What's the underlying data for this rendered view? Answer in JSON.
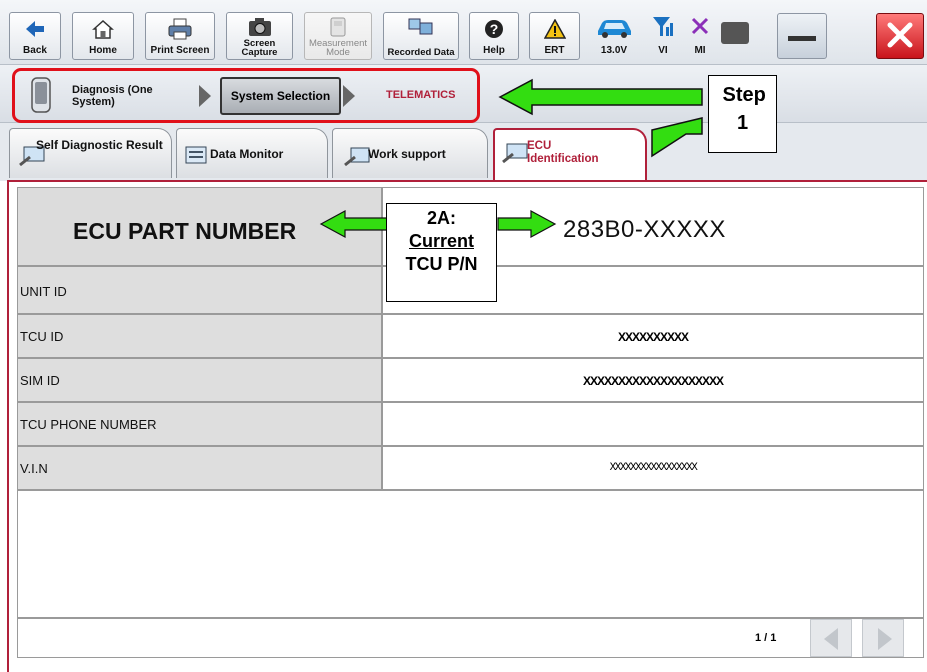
{
  "toolbar": {
    "buttons": [
      {
        "label": "Back"
      },
      {
        "label": "Home"
      },
      {
        "label": "Print Screen"
      },
      {
        "label": "Screen Capture"
      },
      {
        "label": "Measurement Mode"
      },
      {
        "label": "Recorded Data"
      },
      {
        "label": "Help"
      },
      {
        "label": "ERT"
      }
    ],
    "status": {
      "voltage": "13.0V",
      "vi": "VI",
      "mi": "MI"
    }
  },
  "breadcrumb": {
    "item1": "Diagnosis (One System)",
    "item2": "System Selection",
    "item3": "TELEMATICS"
  },
  "tabs": [
    {
      "label": "Self Diagnostic Result"
    },
    {
      "label": "Data Monitor"
    },
    {
      "label": "Work support"
    },
    {
      "label": "ECU Identification"
    }
  ],
  "ecu": {
    "part_number_label": "ECU PART NUMBER",
    "part_number_value": "283B0-XXXXX",
    "rows": [
      {
        "label": "UNIT ID",
        "value": ""
      },
      {
        "label": "TCU ID",
        "value": "XXXXXXXXXX"
      },
      {
        "label": "SIM ID",
        "value": "XXXXXXXXXXXXXXXXXXXX"
      },
      {
        "label": "TCU PHONE NUMBER",
        "value": ""
      },
      {
        "label": "V.I.N",
        "value": "XXXXXXXXXXXXXXXXX"
      }
    ]
  },
  "pagination": {
    "text": "1 / 1"
  },
  "annotations": {
    "step1": "Step 1",
    "step2a_line1": "2A:",
    "step2a_line2": "Current",
    "step2a_line3": "TCU P/N"
  },
  "colors": {
    "annotation_red": "#e0101a",
    "arrow_green": "#33dd11",
    "tab_accent": "#b0203a"
  }
}
